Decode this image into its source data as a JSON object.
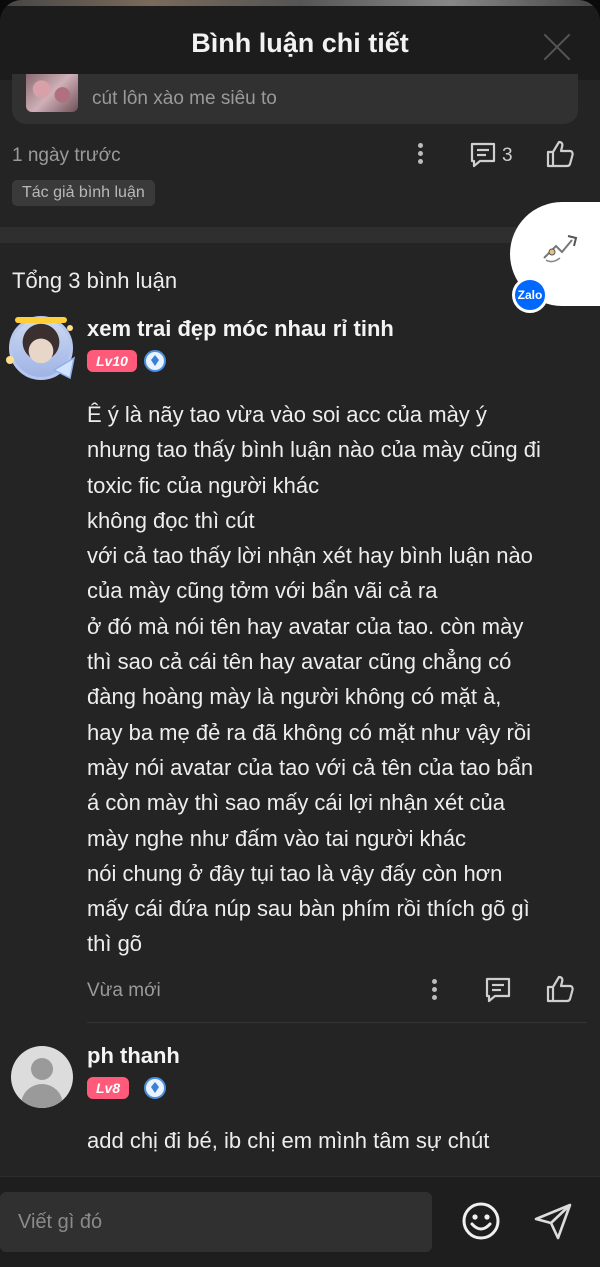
{
  "header": {
    "title": "Bình luận chi tiết"
  },
  "parent_comment": {
    "quoted_text": "cút lôn xào me siêu to",
    "time": "1 ngày trước",
    "reply_count": "3",
    "author_badge": "Tác giả bình luận"
  },
  "replies_section": {
    "total_label": "Tổng 3 bình luận"
  },
  "zalo": {
    "label": "Zalo"
  },
  "comments": [
    {
      "username": "xem trai đẹp móc nhau rỉ tinh",
      "level": "Lv10",
      "lines": [
        "Ê ý là nãy tao vừa vào soi acc của mày ý",
        "nhưng tao thấy bình luận nào của mày cũng đi",
        "toxic fic của người khác",
        "không đọc thì cút",
        "với cả tao thấy lời nhận xét hay bình luận nào",
        "của mày cũng tởm với bẩn vãi cả ra",
        "ở đó mà nói tên hay avatar của tao. còn mày",
        "thì sao cả cái tên hay avatar cũng chẳng có",
        "đàng hoàng mày là người không có mặt à,",
        "hay ba mẹ đẻ ra đã không có mặt như vậy rồi",
        "mày nói avatar của tao với cả tên của tao bẩn",
        "á còn mày thì sao mấy cái lợi nhận xét của",
        "mày nghe như đấm vào tai người khác",
        "nói chung ở đây tụi tao là vậy đấy còn hơn",
        "mấy cái đứa núp sau bàn phím rồi thích gõ gì",
        "thì gõ"
      ],
      "time": "Vừa mới"
    },
    {
      "username": "ph thanh",
      "level": "Lv8",
      "text": "add chị đi bé, ib chị em mình tâm sự chút"
    }
  ],
  "composer": {
    "placeholder": "Viết gì đó"
  }
}
